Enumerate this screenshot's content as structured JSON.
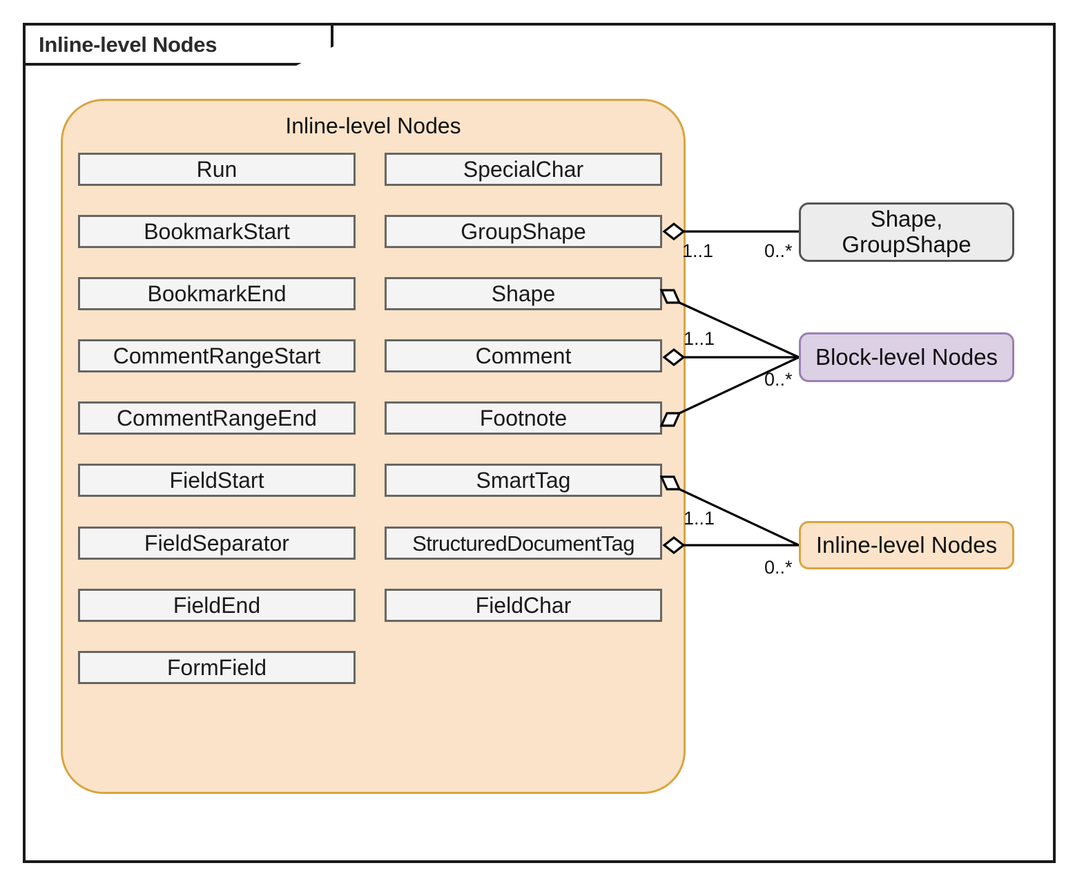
{
  "package": {
    "title": "Inline-level Nodes"
  },
  "group": {
    "title": "Inline-level Nodes",
    "left_column": [
      "Run",
      "BookmarkStart",
      "BookmarkEnd",
      "CommentRangeStart",
      "CommentRangeEnd",
      "FieldStart",
      "FieldSeparator",
      "FieldEnd",
      "FormField"
    ],
    "right_column": [
      "SpecialChar",
      "GroupShape",
      "Shape",
      "Comment",
      "Footnote",
      "SmartTag",
      "StructuredDocumentTag",
      "FieldChar"
    ]
  },
  "external_nodes": [
    {
      "id": "shape-groupshape",
      "label": "Shape,\nGroupShape",
      "line1": "Shape,",
      "line2": "GroupShape",
      "color": "#ECECEC",
      "border": "#555555"
    },
    {
      "id": "block-level-nodes",
      "label": "Block-level Nodes",
      "color": "#DCD0E4",
      "border": "#9C7EB1"
    },
    {
      "id": "inline-level-nodes",
      "label": "Inline-level Nodes",
      "color": "#FAE3C8",
      "border": "#D9A441"
    }
  ],
  "associations": [
    {
      "from": "GroupShape",
      "to": "shape-groupshape",
      "source_multiplicity": "1..1",
      "target_multiplicity": "0..*"
    },
    {
      "from": "Shape",
      "to": "block-level-nodes",
      "source_multiplicity": "",
      "target_multiplicity": ""
    },
    {
      "from": "Comment",
      "to": "block-level-nodes",
      "source_multiplicity": "1..1",
      "target_multiplicity": "0..*"
    },
    {
      "from": "Footnote",
      "to": "block-level-nodes",
      "source_multiplicity": "",
      "target_multiplicity": ""
    },
    {
      "from": "SmartTag",
      "to": "inline-level-nodes",
      "source_multiplicity": "",
      "target_multiplicity": ""
    },
    {
      "from": "StructuredDocumentTag",
      "to": "inline-level-nodes",
      "source_multiplicity": "1..1",
      "target_multiplicity": "0..*"
    }
  ],
  "multiplicity_labels": {
    "m1_1_top": "1..1",
    "m0_star_top": "0..*",
    "m1_1_mid": "1..1",
    "m0_star_mid": "0..*",
    "m1_1_bottom": "1..1",
    "m0_star_bottom": "0..*"
  },
  "colors": {
    "group_fill": "#FAE3C8",
    "group_border": "#D9A441",
    "node_fill": "#F4F4F4",
    "node_border": "#666666",
    "block_fill": "#DCD0E4",
    "block_border": "#9C7EB1",
    "ext_gray_fill": "#ECECEC",
    "frame": "#1a1a1a"
  }
}
